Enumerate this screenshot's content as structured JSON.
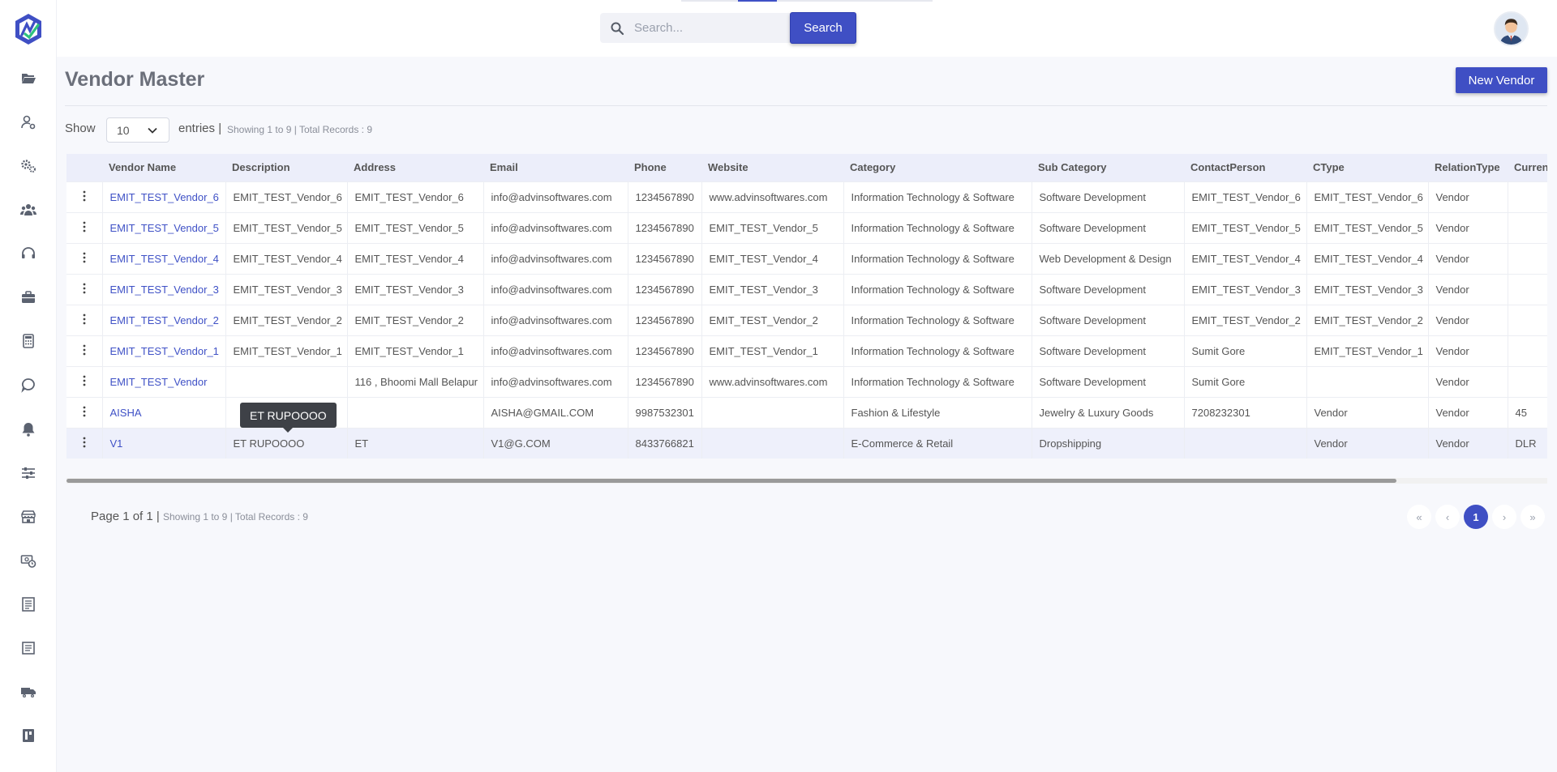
{
  "header": {
    "search_placeholder": "Search...",
    "search_button": "Search"
  },
  "page": {
    "title": "Vendor Master",
    "new_button": "New Vendor"
  },
  "entries": {
    "show_label": "Show",
    "selected": "10",
    "label": "entries |",
    "info": "Showing 1 to 9 | Total Records : 9"
  },
  "table": {
    "columns": [
      "",
      "Vendor Name",
      "Description",
      "Address",
      "Email",
      "Phone",
      "Website",
      "Category",
      "Sub Category",
      "ContactPerson",
      "CType",
      "RelationType",
      "Currency"
    ],
    "rows": [
      [
        "EMIT_TEST_Vendor_6",
        "EMIT_TEST_Vendor_6",
        "EMIT_TEST_Vendor_6",
        "info@advinsoftwares.com",
        "1234567890",
        "www.advinsoftwares.com",
        "Information Technology & Software",
        "Software Development",
        "EMIT_TEST_Vendor_6",
        "EMIT_TEST_Vendor_6",
        "Vendor",
        ""
      ],
      [
        "EMIT_TEST_Vendor_5",
        "EMIT_TEST_Vendor_5",
        "EMIT_TEST_Vendor_5",
        "info@advinsoftwares.com",
        "1234567890",
        "EMIT_TEST_Vendor_5",
        "Information Technology & Software",
        "Software Development",
        "EMIT_TEST_Vendor_5",
        "EMIT_TEST_Vendor_5",
        "Vendor",
        ""
      ],
      [
        "EMIT_TEST_Vendor_4",
        "EMIT_TEST_Vendor_4",
        "EMIT_TEST_Vendor_4",
        "info@advinsoftwares.com",
        "1234567890",
        "EMIT_TEST_Vendor_4",
        "Information Technology & Software",
        "Web Development & Design",
        "EMIT_TEST_Vendor_4",
        "EMIT_TEST_Vendor_4",
        "Vendor",
        ""
      ],
      [
        "EMIT_TEST_Vendor_3",
        "EMIT_TEST_Vendor_3",
        "EMIT_TEST_Vendor_3",
        "info@advinsoftwares.com",
        "1234567890",
        "EMIT_TEST_Vendor_3",
        "Information Technology & Software",
        "Software Development",
        "EMIT_TEST_Vendor_3",
        "EMIT_TEST_Vendor_3",
        "Vendor",
        ""
      ],
      [
        "EMIT_TEST_Vendor_2",
        "EMIT_TEST_Vendor_2",
        "EMIT_TEST_Vendor_2",
        "info@advinsoftwares.com",
        "1234567890",
        "EMIT_TEST_Vendor_2",
        "Information Technology & Software",
        "Software Development",
        "EMIT_TEST_Vendor_2",
        "EMIT_TEST_Vendor_2",
        "Vendor",
        ""
      ],
      [
        "EMIT_TEST_Vendor_1",
        "EMIT_TEST_Vendor_1",
        "EMIT_TEST_Vendor_1",
        "info@advinsoftwares.com",
        "1234567890",
        "EMIT_TEST_Vendor_1",
        "Information Technology & Software",
        "Software Development",
        "Sumit Gore",
        "EMIT_TEST_Vendor_1",
        "Vendor",
        ""
      ],
      [
        "EMIT_TEST_Vendor",
        "",
        "116 , Bhoomi Mall Belapur",
        "info@advinsoftwares.com",
        "1234567890",
        "www.advinsoftwares.com",
        "Information Technology & Software",
        "Software Development",
        "Sumit Gore",
        "",
        "Vendor",
        ""
      ],
      [
        "AISHA",
        "",
        "",
        "AISHA@GMAIL.COM",
        "9987532301",
        "",
        "Fashion & Lifestyle",
        "Jewelry & Luxury Goods",
        "7208232301",
        "Vendor",
        "Vendor",
        "45"
      ],
      [
        "V1",
        "ET RUPOOOO",
        "ET",
        "V1@G.COM",
        "8433766821",
        "",
        "E-Commerce & Retail",
        "Dropshipping",
        "",
        "Vendor",
        "Vendor",
        "DLR"
      ]
    ]
  },
  "tooltip": "ET RUPOOOO",
  "footer": {
    "page_info": "Page 1 of 1 |",
    "page_info_small": "Showing 1 to 9 | Total Records : 9",
    "first": "«",
    "prev": "‹",
    "current": "1",
    "next": "›",
    "last": "»"
  }
}
